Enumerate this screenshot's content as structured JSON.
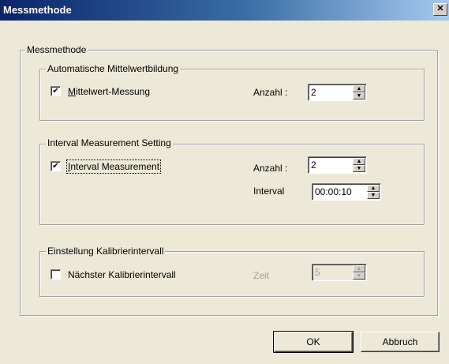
{
  "window": {
    "title": "Messmethode",
    "close_icon": "close-icon"
  },
  "main_group": {
    "legend": "Messmethode"
  },
  "auto_group": {
    "legend": "Automatische Mittelwertbildung",
    "checkbox_label": "Mittelwert-Messung",
    "checked": true,
    "count_label": "Anzahl :",
    "count_value": "2"
  },
  "interval_group": {
    "legend": "Interval Measurement Setting",
    "checkbox_label": "Interval Measurement",
    "checked": true,
    "count_label": "Anzahl :",
    "count_value": "2",
    "interval_label": "Interval",
    "interval_value": "00:00:10"
  },
  "calib_group": {
    "legend": "Einstellung Kalibrierintervall",
    "checkbox_label": "Nächster Kalibrierintervall",
    "checked": false,
    "time_label": "Zeit",
    "time_value": "5"
  },
  "buttons": {
    "ok": "OK",
    "cancel": "Abbruch"
  }
}
